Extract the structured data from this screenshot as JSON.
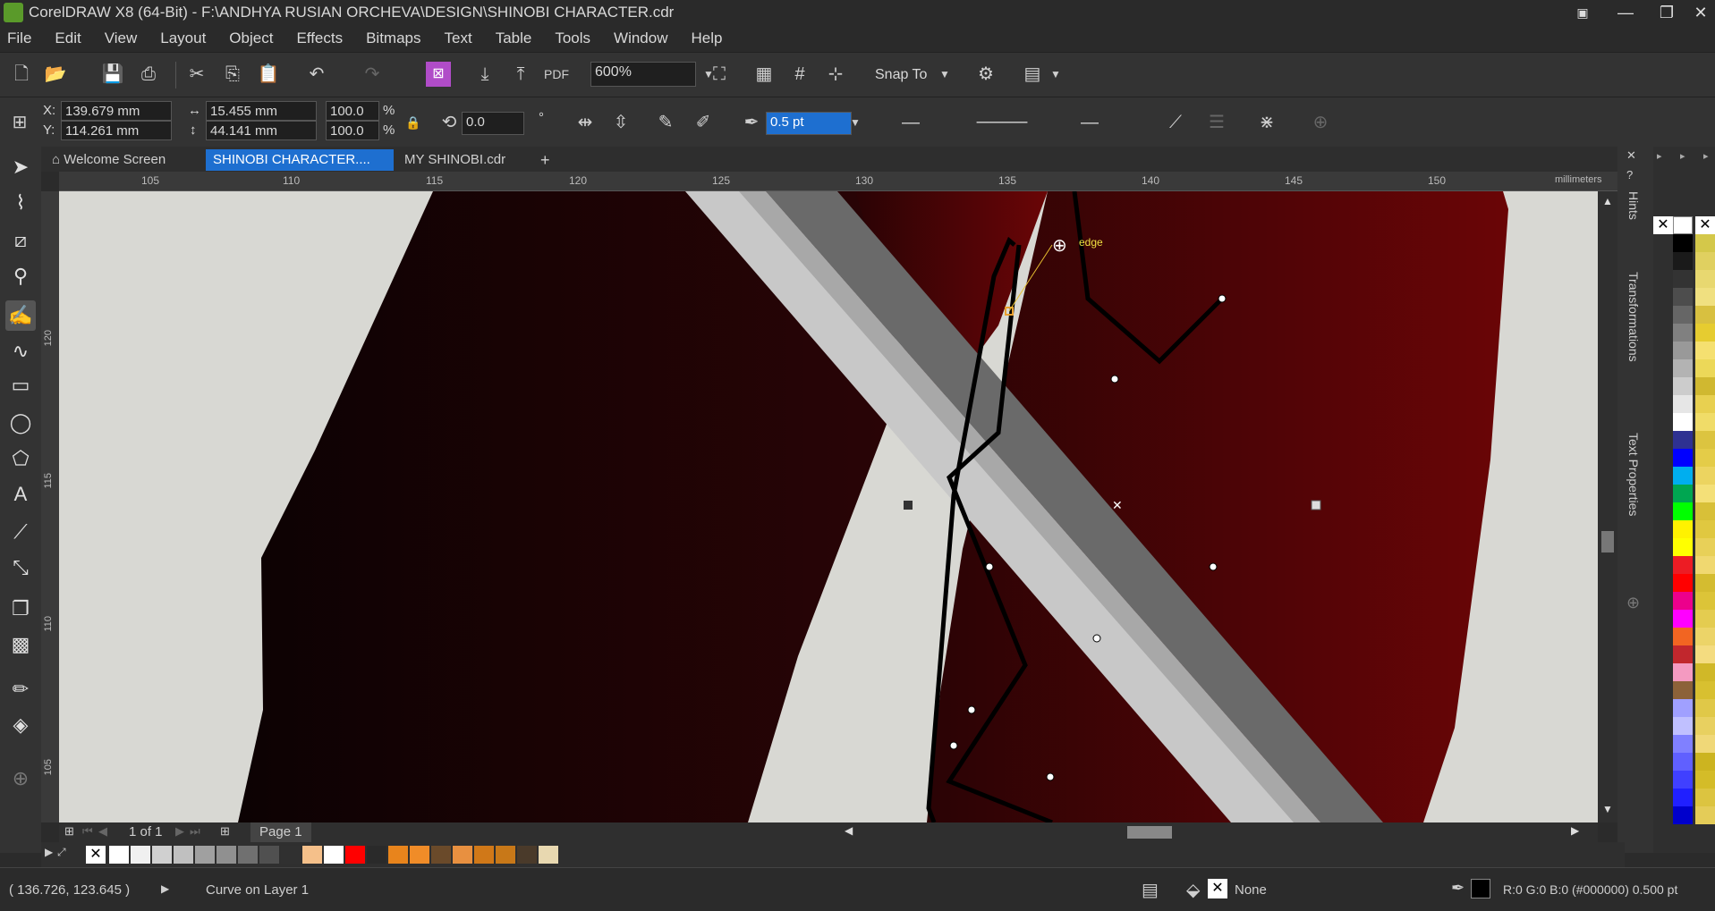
{
  "titlebar": {
    "title": "CorelDRAW X8 (64-Bit) - F:\\ANDHYA RUSIAN ORCHEVA\\DESIGN\\SHINOBI CHARACTER.cdr",
    "restore_icon": "restore-icon",
    "minimize": "—",
    "maximize": "❐",
    "close": "✕"
  },
  "menu": [
    "File",
    "Edit",
    "View",
    "Layout",
    "Object",
    "Effects",
    "Bitmaps",
    "Text",
    "Table",
    "Tools",
    "Window",
    "Help"
  ],
  "standard_toolbar": {
    "zoom_value": "600%",
    "snap_to": "Snap To"
  },
  "property_bar": {
    "x_label": "X:",
    "x_value": "139.679 mm",
    "y_label": "Y:",
    "y_value": "114.261 mm",
    "width_value": "15.455 mm",
    "height_value": "44.141 mm",
    "scale_w": "100.0",
    "scale_h": "100.0",
    "pct": "%",
    "rotation": "0.0",
    "degree": "°",
    "outline_width": "0.5 pt"
  },
  "tabs": [
    {
      "label": "Welcome Screen"
    },
    {
      "label": "SHINOBI CHARACTER...."
    },
    {
      "label": "MY SHINOBI.cdr"
    }
  ],
  "ruler": {
    "h_ticks": [
      "105",
      "110",
      "115",
      "120",
      "125",
      "130",
      "135",
      "140",
      "145",
      "150"
    ],
    "unit": "millimeters",
    "v_ticks": [
      "120",
      "115",
      "110",
      "105"
    ]
  },
  "snap_hint": "edge",
  "page_nav": {
    "counter": "1 of 1",
    "page_tab": "Page 1"
  },
  "dockers": [
    "Hints",
    "Transformations",
    "Text Properties"
  ],
  "palette_colors": [
    "#ffffff",
    "#000000",
    "#1a1a1a",
    "#333333",
    "#4d4d4d",
    "#666666",
    "#808080",
    "#999999",
    "#b3b3b3",
    "#cccccc",
    "#e6e6e6",
    "#ffffff",
    "#2e3192",
    "#0000ff",
    "#00aeef",
    "#00a651",
    "#00ff00",
    "#fff200",
    "#ffff00",
    "#ed1c24",
    "#ff0000",
    "#ec008c",
    "#ff00ff",
    "#f26522",
    "#c1272d",
    "#f49ac1",
    "#8c6239",
    "#a0a0ff",
    "#c0c0ff",
    "#8080ff",
    "#6060ff",
    "#4040ff",
    "#2020ff",
    "#0000cc"
  ],
  "palette_yellows": [
    "#d4c84a",
    "#e0d060",
    "#e8d870",
    "#f0e080",
    "#d8c040",
    "#e6cc30",
    "#f5e070",
    "#ecd858",
    "#d0b830",
    "#e8d050",
    "#f0dc68",
    "#dcc440",
    "#e4cc48",
    "#ecd460",
    "#f4e078",
    "#d8c038",
    "#e0c840",
    "#e8d058",
    "#f0d870",
    "#d4bc30",
    "#dcc438",
    "#e4cc50",
    "#ecd468",
    "#f4dc80",
    "#d0b828",
    "#d8c030",
    "#e0c848",
    "#e8d060",
    "#f0d878",
    "#ccb420",
    "#d4bc28",
    "#dcc440",
    "#e4cc58"
  ],
  "doc_palette": [
    "#ffffff",
    "#f0f0f0",
    "#d0d0d0",
    "#c0c0c0",
    "#a0a0a0",
    "#909090",
    "#707070",
    "#505050",
    "#303030",
    "#f5c08a",
    "#ffffff",
    "#ff0000",
    "#2a2a2a",
    "#e8841c",
    "#f08c28",
    "#6a4a2a",
    "#e89040",
    "#d07818",
    "#c87818",
    "#4a3a2a",
    "#e8d8b0"
  ],
  "statusbar": {
    "coords": "( 136.726, 123.645 )",
    "object_info": "Curve on Layer 1",
    "fill_none": "None",
    "outline_info": "R:0 G:0 B:0 (#000000)  0.500 pt"
  }
}
